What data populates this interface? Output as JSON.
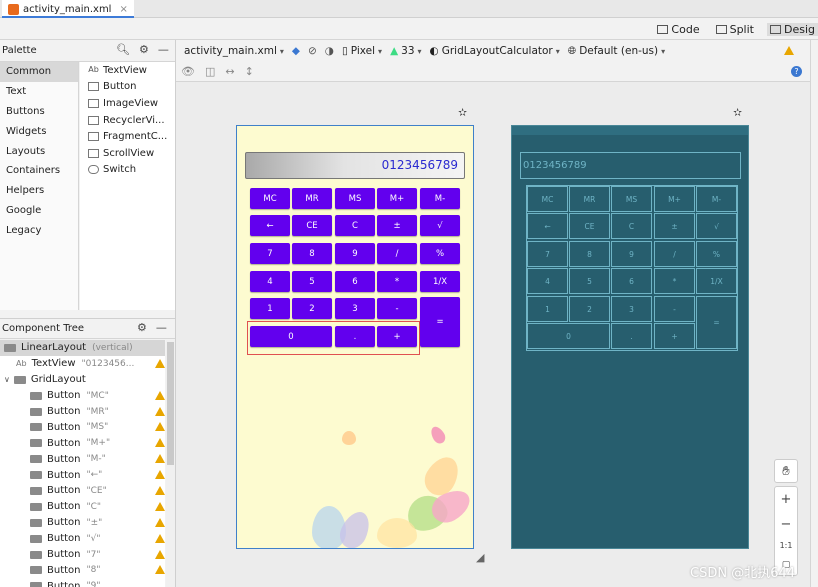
{
  "tab": {
    "file_name": "activity_main.xml",
    "close": "×"
  },
  "view_modes": [
    {
      "label": "Code"
    },
    {
      "label": "Split"
    },
    {
      "label": "Desig"
    }
  ],
  "palette": {
    "title": "Palette",
    "categories": [
      "Common",
      "Text",
      "Buttons",
      "Widgets",
      "Layouts",
      "Containers",
      "Helpers",
      "Google",
      "Legacy"
    ],
    "widgets": [
      {
        "icon": "Ab",
        "label": "TextView"
      },
      {
        "icon": "",
        "label": "Button"
      },
      {
        "icon": "",
        "label": "ImageView"
      },
      {
        "icon": "",
        "label": "RecyclerVi..."
      },
      {
        "icon": "",
        "label": "FragmentC..."
      },
      {
        "icon": "",
        "label": "ScrollView"
      },
      {
        "icon": "",
        "label": "Switch"
      }
    ]
  },
  "component_tree": {
    "title": "Component Tree",
    "rows": [
      {
        "label": "LinearLayout",
        "sub": "(vertical)",
        "indent": 0,
        "warn": false
      },
      {
        "label": "TextView",
        "sub": "\"0123456...",
        "indent": 1,
        "warn": true
      },
      {
        "label": "GridLayout",
        "sub": "",
        "indent": 0,
        "warn": false
      },
      {
        "label": "Button",
        "sub": "\"MC\"",
        "indent": 2,
        "warn": true
      },
      {
        "label": "Button",
        "sub": "\"MR\"",
        "indent": 2,
        "warn": true
      },
      {
        "label": "Button",
        "sub": "\"MS\"",
        "indent": 2,
        "warn": true
      },
      {
        "label": "Button",
        "sub": "\"M+\"",
        "indent": 2,
        "warn": true
      },
      {
        "label": "Button",
        "sub": "\"M-\"",
        "indent": 2,
        "warn": true
      },
      {
        "label": "Button",
        "sub": "\"←\"",
        "indent": 2,
        "warn": true
      },
      {
        "label": "Button",
        "sub": "\"CE\"",
        "indent": 2,
        "warn": true
      },
      {
        "label": "Button",
        "sub": "\"C\"",
        "indent": 2,
        "warn": true
      },
      {
        "label": "Button",
        "sub": "\"±\"",
        "indent": 2,
        "warn": true
      },
      {
        "label": "Button",
        "sub": "\"√\"",
        "indent": 2,
        "warn": true
      },
      {
        "label": "Button",
        "sub": "\"7\"",
        "indent": 2,
        "warn": true
      },
      {
        "label": "Button",
        "sub": "\"8\"",
        "indent": 2,
        "warn": true
      },
      {
        "label": "Button",
        "sub": "\"9\"",
        "indent": 2,
        "warn": false
      }
    ]
  },
  "design_toolbar": {
    "file": "activity_main.xml",
    "device": "Pixel",
    "api": "33",
    "theme": "GridLayoutCalculator",
    "locale": "Default (en-us)"
  },
  "calculator": {
    "display": "0123456789",
    "buttons": [
      {
        "label": "MC",
        "row": 0,
        "col": 0
      },
      {
        "label": "MR",
        "row": 0,
        "col": 1
      },
      {
        "label": "MS",
        "row": 0,
        "col": 2
      },
      {
        "label": "M+",
        "row": 0,
        "col": 3
      },
      {
        "label": "M-",
        "row": 0,
        "col": 4
      },
      {
        "label": "←",
        "row": 1,
        "col": 0
      },
      {
        "label": "CE",
        "row": 1,
        "col": 1
      },
      {
        "label": "C",
        "row": 1,
        "col": 2
      },
      {
        "label": "±",
        "row": 1,
        "col": 3
      },
      {
        "label": "√",
        "row": 1,
        "col": 4
      },
      {
        "label": "7",
        "row": 2,
        "col": 0
      },
      {
        "label": "8",
        "row": 2,
        "col": 1
      },
      {
        "label": "9",
        "row": 2,
        "col": 2
      },
      {
        "label": "/",
        "row": 2,
        "col": 3
      },
      {
        "label": "%",
        "row": 2,
        "col": 4
      },
      {
        "label": "4",
        "row": 3,
        "col": 0
      },
      {
        "label": "5",
        "row": 3,
        "col": 1
      },
      {
        "label": "6",
        "row": 3,
        "col": 2
      },
      {
        "label": "*",
        "row": 3,
        "col": 3
      },
      {
        "label": "1/X",
        "row": 3,
        "col": 4
      },
      {
        "label": "1",
        "row": 4,
        "col": 0
      },
      {
        "label": "2",
        "row": 4,
        "col": 1
      },
      {
        "label": "3",
        "row": 4,
        "col": 2
      },
      {
        "label": "-",
        "row": 4,
        "col": 3
      },
      {
        "label": "0",
        "row": 5,
        "col": 0,
        "span": 2
      },
      {
        "label": ".",
        "row": 5,
        "col": 2
      },
      {
        "label": "+",
        "row": 5,
        "col": 3
      },
      {
        "label": "=",
        "row": 4,
        "col": 4,
        "rowspan": 2
      }
    ]
  },
  "zoom": {
    "zoom_in": "+",
    "zoom_out": "−",
    "fit": "1:1"
  },
  "watermark": "CSDN @北执644",
  "colors": {
    "button_purple": "#6200ee",
    "phone_bg": "#fdfbd0",
    "blueprint_bg": "#275e6e",
    "selection_blue": "#3f80c9"
  }
}
